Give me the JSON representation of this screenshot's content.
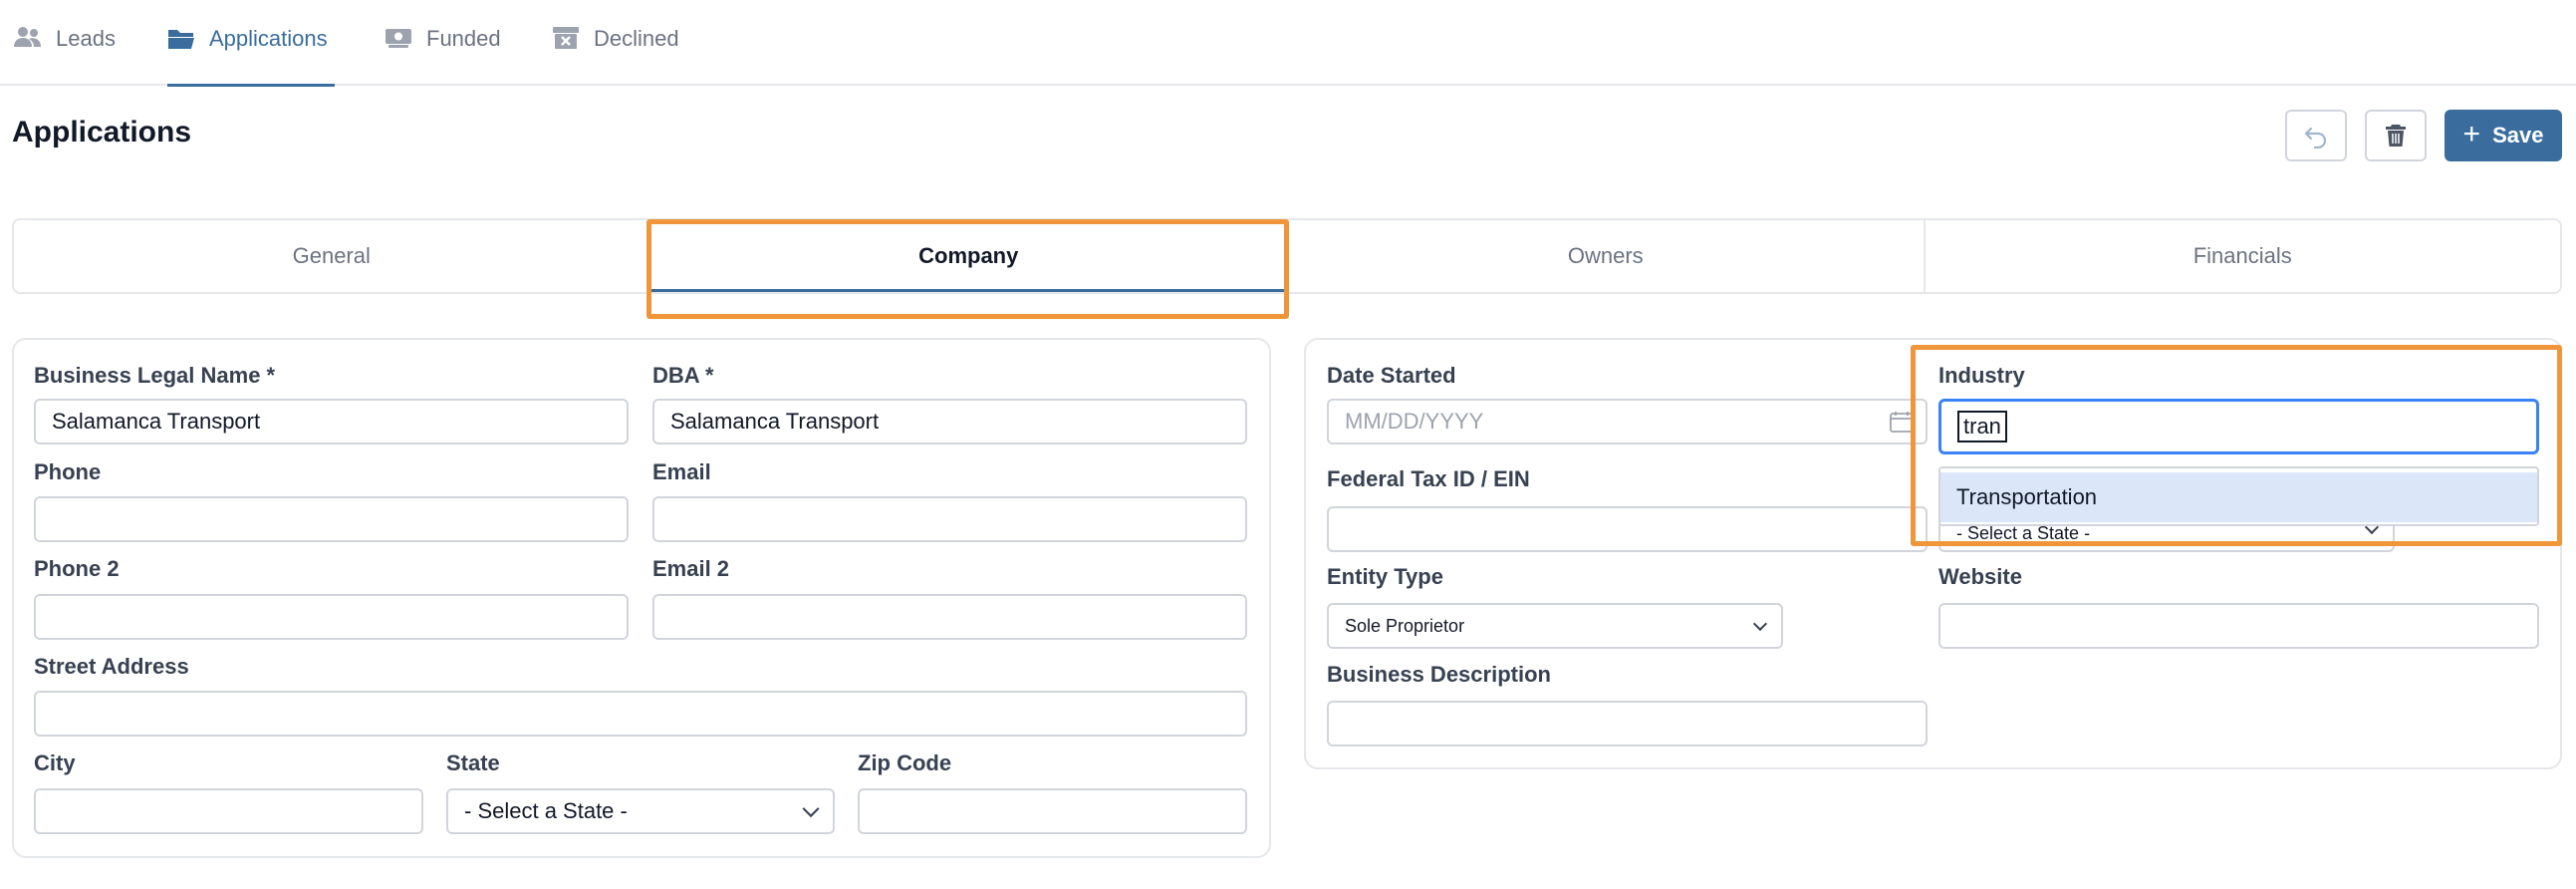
{
  "nav": {
    "items": [
      {
        "label": "Leads",
        "icon": "users-icon"
      },
      {
        "label": "Applications",
        "icon": "folder-icon"
      },
      {
        "label": "Funded",
        "icon": "money-icon"
      },
      {
        "label": "Declined",
        "icon": "archive-x-icon"
      }
    ],
    "active": "Applications"
  },
  "page": {
    "title": "Applications"
  },
  "toolbar": {
    "undo_icon": "undo-icon",
    "delete_icon": "trash-icon",
    "save_label": "Save"
  },
  "tabs": [
    {
      "label": "General"
    },
    {
      "label": "Company"
    },
    {
      "label": "Owners"
    },
    {
      "label": "Financials"
    }
  ],
  "left_form": {
    "business_legal_name": {
      "label": "Business Legal Name *",
      "value": "Salamanca Transport"
    },
    "dba": {
      "label": "DBA *",
      "value": "Salamanca Transport"
    },
    "phone": {
      "label": "Phone",
      "value": ""
    },
    "email": {
      "label": "Email",
      "value": ""
    },
    "phone2": {
      "label": "Phone 2",
      "value": ""
    },
    "email2": {
      "label": "Email 2",
      "value": ""
    },
    "street": {
      "label": "Street Address",
      "value": ""
    },
    "city": {
      "label": "City",
      "value": ""
    },
    "state": {
      "label": "State",
      "value": "- Select a State -"
    },
    "zip": {
      "label": "Zip Code",
      "value": ""
    }
  },
  "right_form": {
    "date_started": {
      "label": "Date Started",
      "placeholder": "MM/DD/YYYY"
    },
    "industry": {
      "label": "Industry",
      "value": "tran",
      "suggestion": "Transportation"
    },
    "tax_id": {
      "label": "Federal Tax ID / EIN",
      "value": ""
    },
    "hidden_state": {
      "value": "- Select a State -"
    },
    "entity_type": {
      "label": "Entity Type",
      "value": "Sole Proprietor"
    },
    "website": {
      "label": "Website",
      "value": ""
    },
    "business_description": {
      "label": "Business Description",
      "value": ""
    }
  },
  "colors": {
    "accent": "#3a6d9e",
    "highlight": "#f0963a",
    "focus": "#3b82f6",
    "suggestion_bg": "#dbe7f8"
  }
}
